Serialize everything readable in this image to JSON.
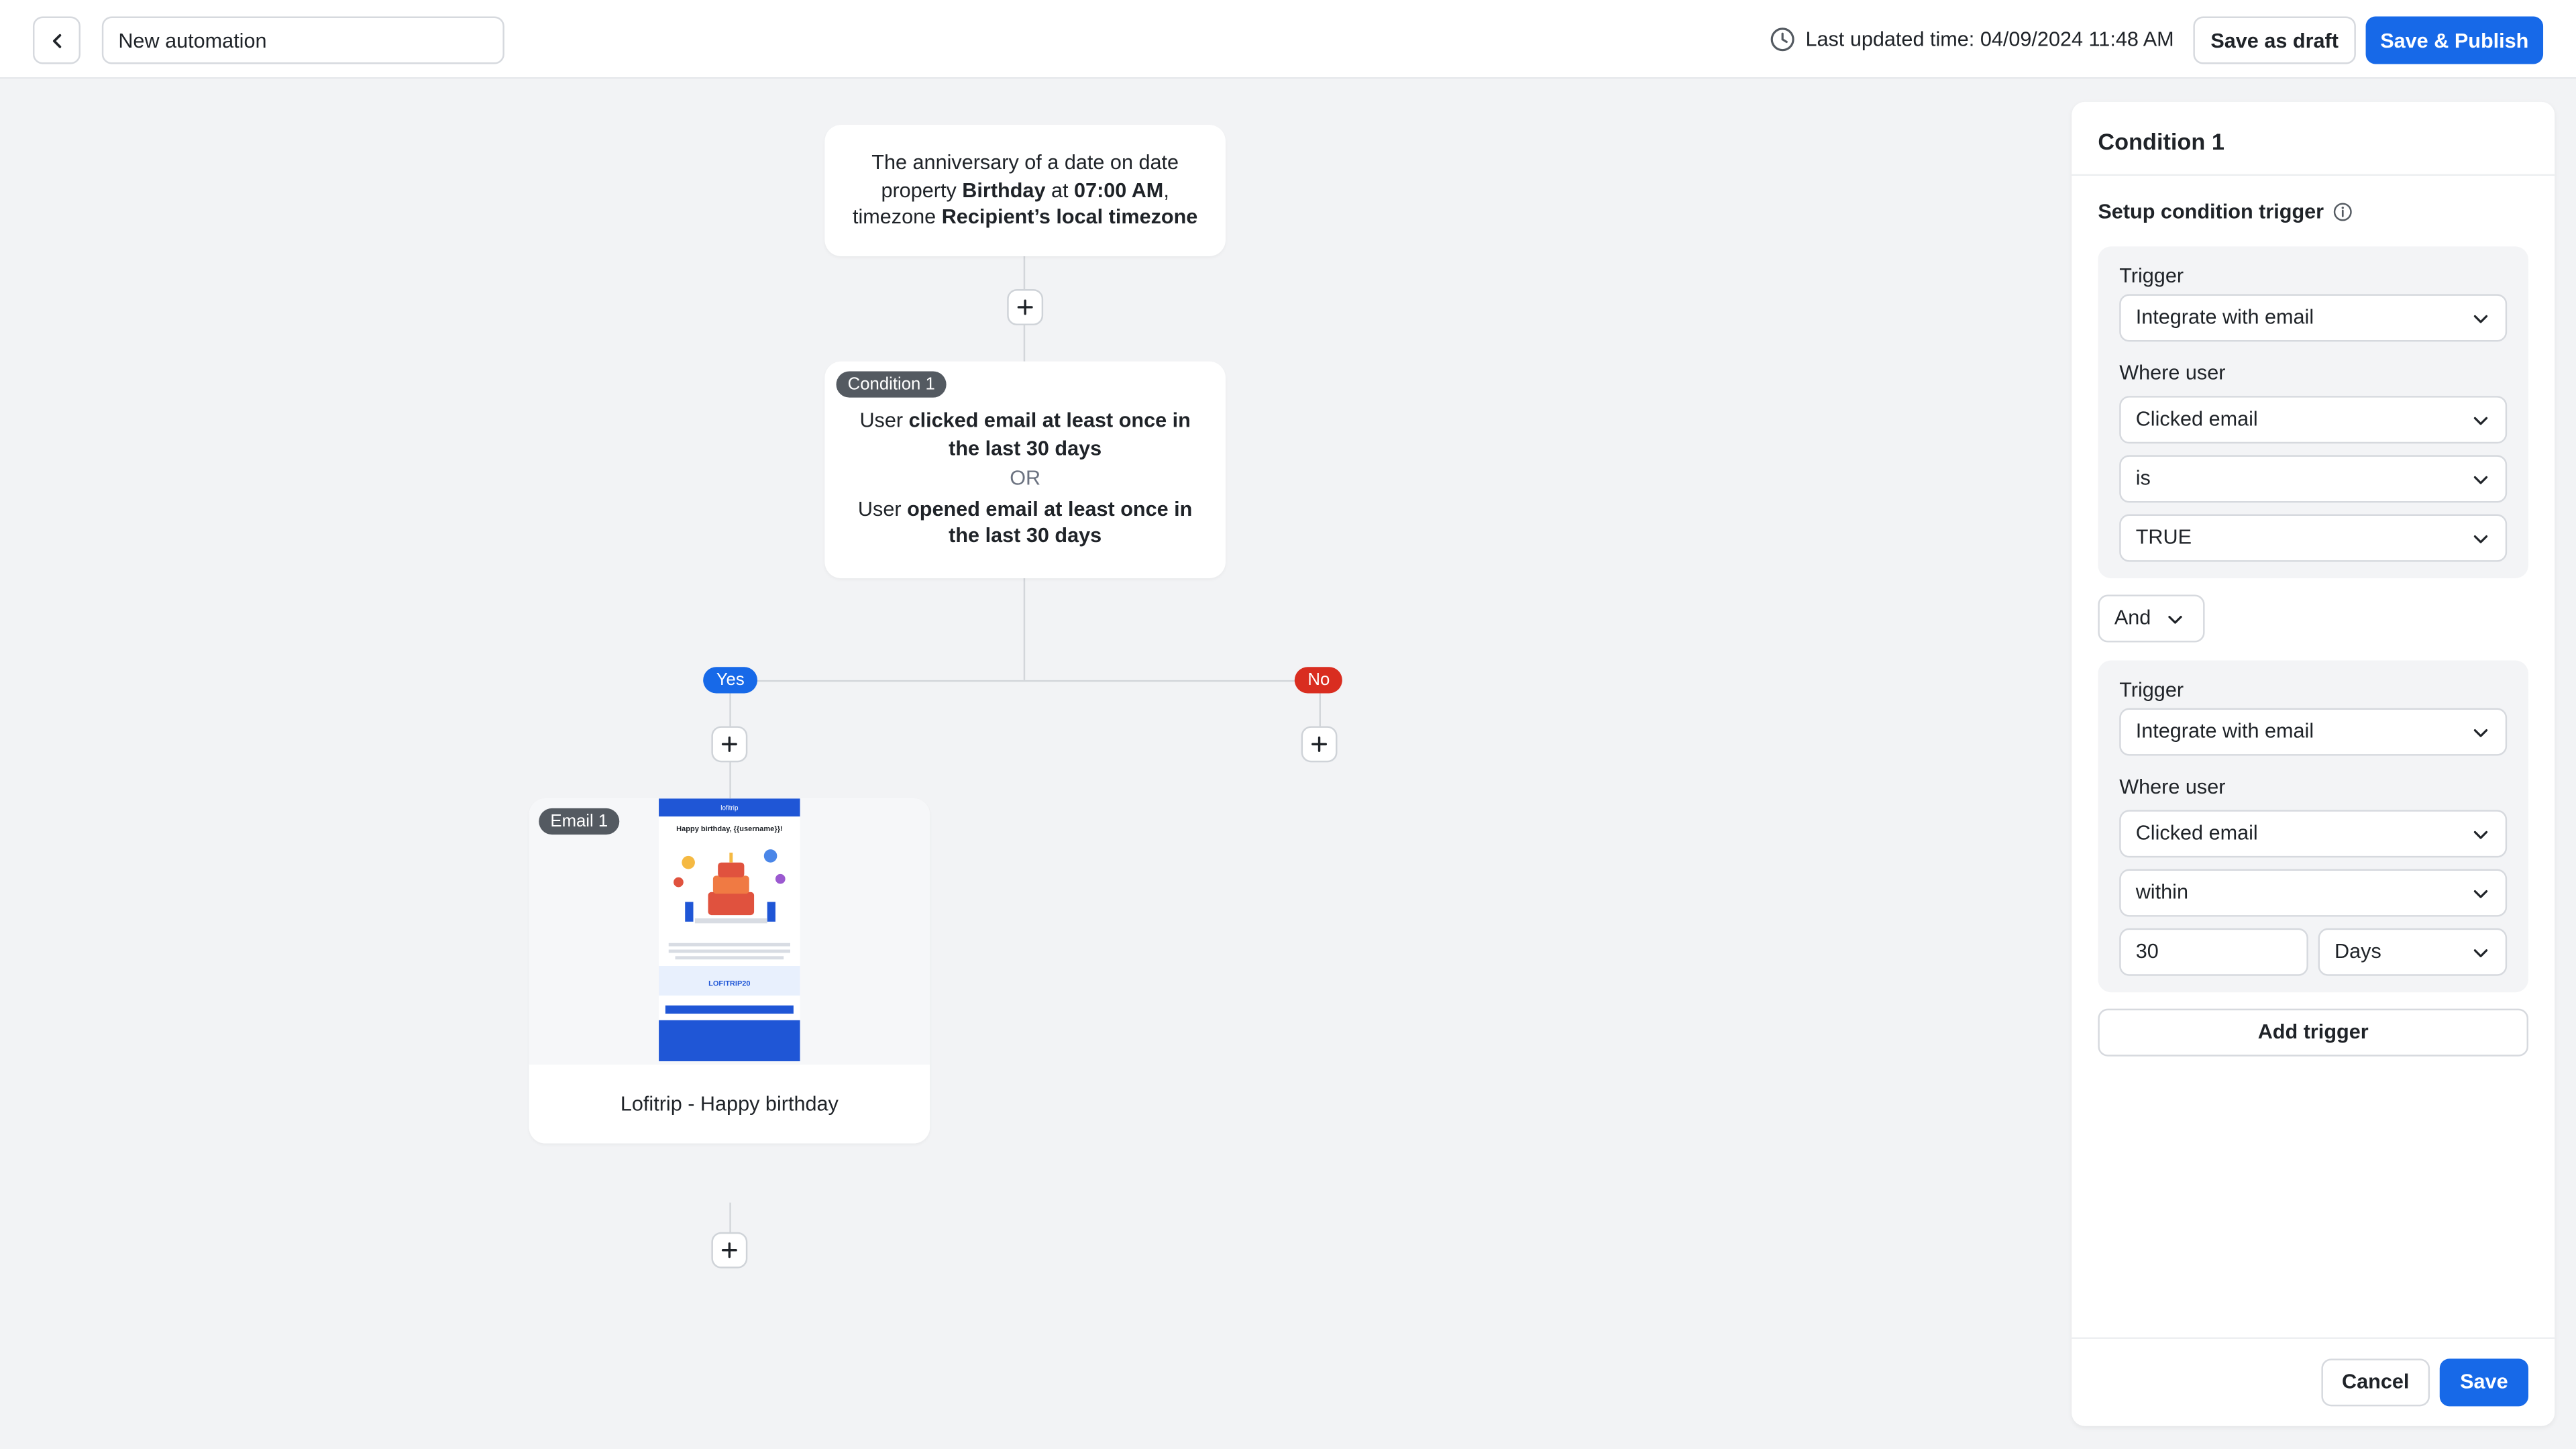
{
  "header": {
    "back_icon": "chevron-left-icon",
    "automation_name": "New automation",
    "clock_icon": "clock-icon",
    "last_updated": "Last updated time: 04/09/2024 11:48 AM",
    "save_draft_label": "Save as draft",
    "save_publish_label": "Save & Publish",
    "accent_color": "#1769e8"
  },
  "flow": {
    "trigger": {
      "t1": "The anniversary of a date on date property ",
      "b1": "Birthday",
      "t2": " at ",
      "b2": "07:00 AM",
      "t3": ", timezone ",
      "b3": "Recipient’s local timezone"
    },
    "condition": {
      "badge": "Condition 1",
      "line1_prefix": "User ",
      "line1_bold": "clicked email at least once in the last 30 days",
      "or": "OR",
      "line2_prefix": "User ",
      "line2_bold": "opened email at least once in the last 30 days"
    },
    "yes_label": "Yes",
    "no_label": "No",
    "email": {
      "badge": "Email 1",
      "title": "Lofitrip - Happy birthday",
      "preview": {
        "brand": "lofitrip",
        "heading": "Happy birthday, {{username}}!",
        "code": "LOFITRIP20"
      }
    },
    "plus_icon": "plus-icon"
  },
  "panel": {
    "title": "Condition 1",
    "section_title": "Setup condition trigger",
    "info_icon": "info-icon",
    "group1": {
      "trigger_label": "Trigger",
      "trigger_value": "Integrate with email",
      "where_label": "Where user",
      "event_value": "Clicked email",
      "operator_value": "is",
      "value_value": "TRUE"
    },
    "combinator": "And",
    "group2": {
      "trigger_label": "Trigger",
      "trigger_value": "Integrate with email",
      "where_label": "Where user",
      "event_value": "Clicked email",
      "operator_value": "within",
      "number_value": "30",
      "unit_value": "Days"
    },
    "add_trigger_label": "Add trigger",
    "cancel_label": "Cancel",
    "save_label": "Save"
  }
}
